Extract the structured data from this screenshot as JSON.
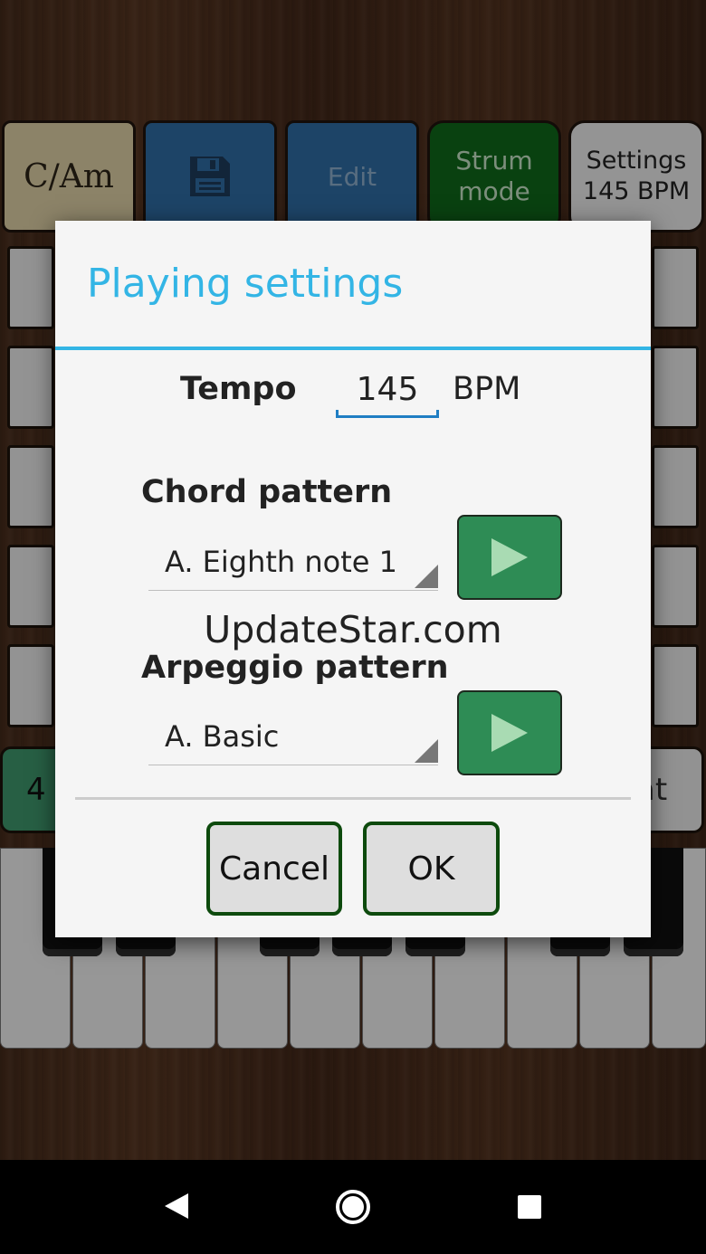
{
  "toolbar": {
    "key_label": "C/Am",
    "save_icon": "save-icon",
    "edit_label": "Edit",
    "strum_label_line1": "Strum",
    "strum_label_line2": "mode",
    "settings_label_line1": "Settings",
    "settings_label_line2": "145 BPM"
  },
  "bottom_row": {
    "left_label": "4",
    "right_label_fragment": "at"
  },
  "dialog": {
    "title": "Playing settings",
    "tempo": {
      "label": "Tempo",
      "value": "145",
      "unit": "BPM"
    },
    "chord_pattern": {
      "label": "Chord pattern",
      "selected": "A. Eighth note 1"
    },
    "arpeggio_pattern": {
      "label": "Arpeggio pattern",
      "selected": "A. Basic"
    },
    "watermark": "UpdateStar.com",
    "cancel_label": "Cancel",
    "ok_label": "OK"
  },
  "navbar": {
    "back_icon": "back-icon",
    "home_icon": "home-icon",
    "recents_icon": "recents-icon"
  },
  "colors": {
    "accent": "#33b5e5",
    "play_button": "#2e8c55",
    "dialog_button_border": "#0d4a0d",
    "strum_button": "#0f6a1a",
    "save_button": "#2f6ea7"
  }
}
